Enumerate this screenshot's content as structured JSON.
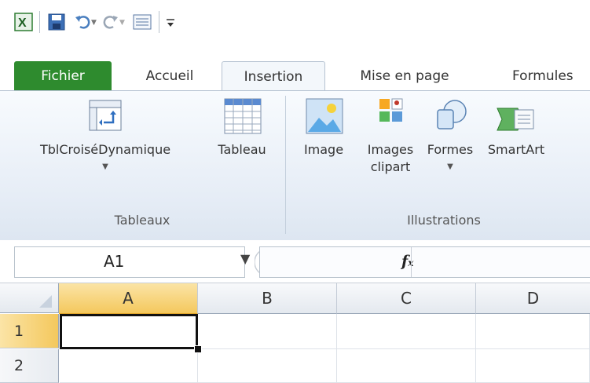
{
  "tabs": {
    "file": "Fichier",
    "home": "Accueil",
    "insert": "Insertion",
    "page_layout": "Mise en page",
    "formulas": "Formules"
  },
  "ribbon": {
    "pivot_table": "TblCroiséDynamique",
    "table": "Tableau",
    "image": "Image",
    "clipart_line1": "Images",
    "clipart_line2": "clipart",
    "shapes": "Formes",
    "smartart": "SmartArt",
    "group_tables": "Tableaux",
    "group_illustrations": "Illustrations"
  },
  "formula_bar": {
    "name_box": "A1",
    "fx": "fx",
    "formula": ""
  },
  "grid": {
    "columns": [
      "A",
      "B",
      "C",
      "D"
    ],
    "rows": [
      "1",
      "2"
    ],
    "selected_cell": "A1"
  },
  "colors": {
    "file_tab": "#2e8b2e",
    "selected_header": "#f6cf6e",
    "ribbon_bg": "#e6edf6"
  },
  "icons": [
    "excel-logo-icon",
    "save-icon",
    "undo-icon",
    "redo-icon",
    "form-icon",
    "customize-qat-icon",
    "pivot-table-icon",
    "table-icon",
    "image-icon",
    "clipart-icon",
    "shapes-icon",
    "smartart-icon"
  ]
}
